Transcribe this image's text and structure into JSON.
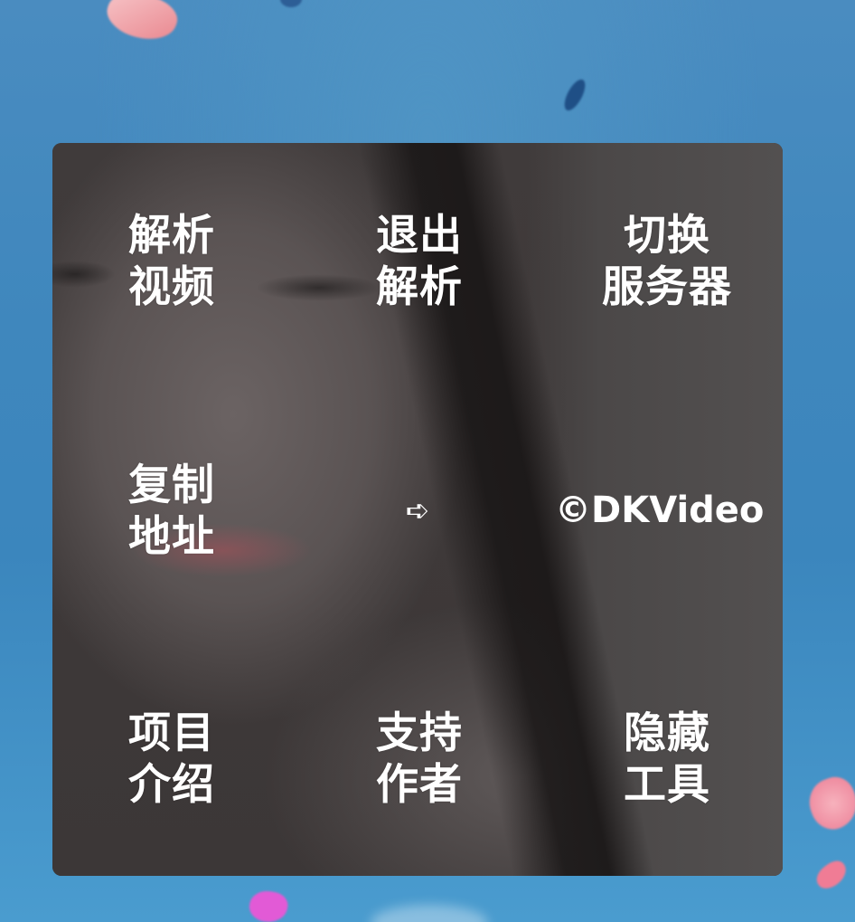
{
  "menu": {
    "parse_video": [
      "解析",
      "视频"
    ],
    "exit_parse": [
      "退出",
      "解析"
    ],
    "switch_server": [
      "切换",
      "服务器"
    ],
    "copy_address": [
      "复制",
      "地址"
    ],
    "project_intro": [
      "项目",
      "介绍"
    ],
    "support_author": [
      "支持",
      "作者"
    ],
    "hide_tool": [
      "隐藏",
      "工具"
    ],
    "arrow_icon": "➪",
    "credit": "©DKVideo"
  }
}
